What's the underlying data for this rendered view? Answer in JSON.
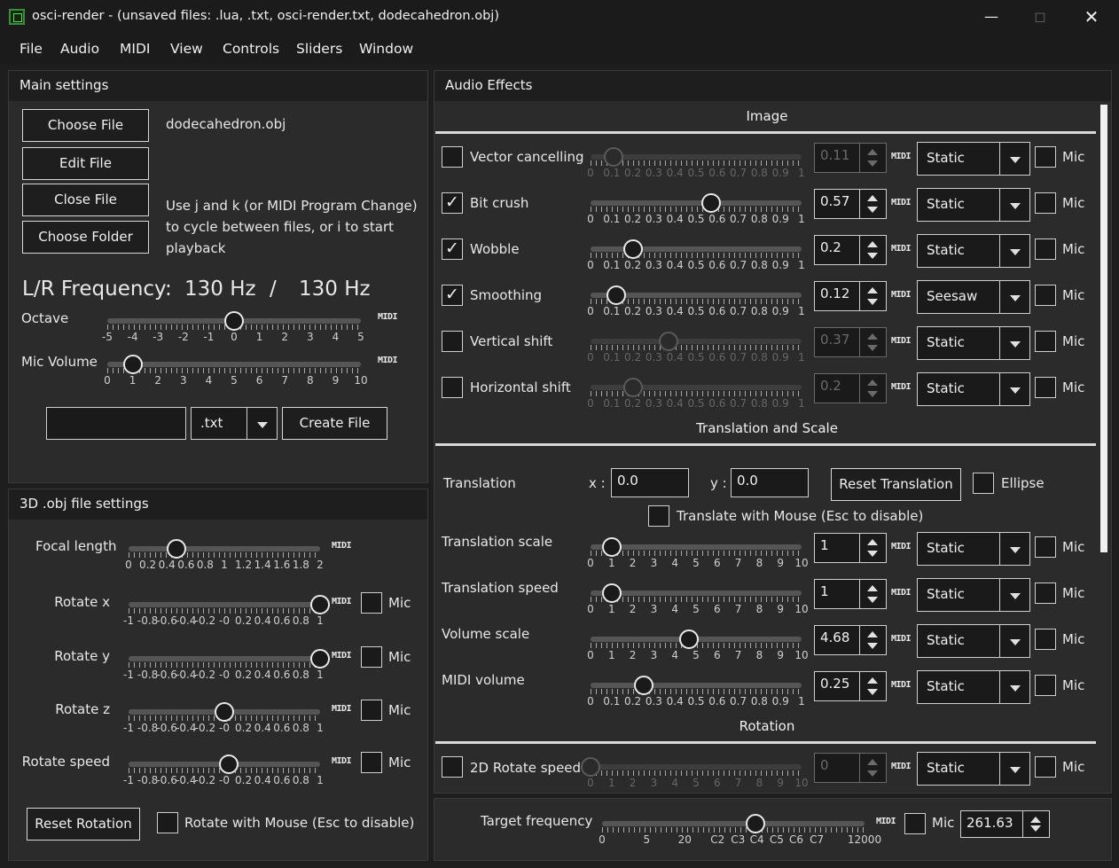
{
  "window": {
    "title": "osci-render - (unsaved files: .lua, .txt, osci-render.txt, dodecahedron.obj)",
    "controls": [
      "minimize",
      "maximize",
      "close"
    ]
  },
  "menu": [
    "File",
    "Audio",
    "MIDI",
    "View",
    "Controls",
    "Sliders",
    "Window"
  ],
  "main_settings": {
    "header": "Main settings",
    "buttons": [
      "Choose File",
      "Edit File",
      "Close File",
      "Choose Folder"
    ],
    "current_file": "dodecahedron.obj",
    "hint": [
      "Use j and k (or MIDI Program Change)",
      "to cycle between files, or i to start",
      "playback"
    ],
    "frequency_label": "L/R Frequency:",
    "frequency_left": "130 Hz",
    "frequency_sep": "/",
    "frequency_right": "130 Hz",
    "octave": {
      "label": "Octave",
      "ticks": [
        "-5",
        "-4",
        "-3",
        "-2",
        "-1",
        "0",
        "1",
        "2",
        "3",
        "4",
        "5"
      ],
      "value": 0,
      "min": -5,
      "max": 5
    },
    "mic_volume": {
      "label": "Mic Volume",
      "ticks": [
        "0",
        "1",
        "2",
        "3",
        "4",
        "5",
        "6",
        "7",
        "8",
        "9",
        "10"
      ],
      "value": 1,
      "min": 0,
      "max": 10
    },
    "new_file_name": "",
    "extension": ".txt",
    "create_label": "Create File"
  },
  "obj_settings": {
    "header": "3D .obj file settings",
    "focal": {
      "label": "Focal length",
      "ticks": [
        "0",
        "0.2",
        "0.4",
        "0.6",
        "0.8",
        "1",
        "1.2",
        "1.4",
        "1.6",
        "1.8",
        "2"
      ],
      "value": 0.5,
      "min": 0,
      "max": 2
    },
    "rows": [
      {
        "label": "Rotate x",
        "value": 1,
        "mic": false
      },
      {
        "label": "Rotate y",
        "value": 1,
        "mic": false
      },
      {
        "label": "Rotate z",
        "value": 0,
        "mic": false
      },
      {
        "label": "Rotate speed",
        "value": 0.05,
        "mic": false
      }
    ],
    "rot_ticks": [
      "-1",
      "-0.8",
      "-0.6",
      "-0.4",
      "-0.2",
      "-0",
      "0.2",
      "0.4",
      "0.6",
      "0.8",
      "1"
    ],
    "mic_label": "Mic",
    "reset_rotation": "Reset Rotation",
    "rotate_mouse": "Rotate with Mouse (Esc to disable)"
  },
  "effects": {
    "header": "Audio Effects",
    "image_title": "Image",
    "translation_title": "Translation and Scale",
    "rotation_title": "Rotation",
    "image_rows": [
      {
        "label": "Vector cancelling",
        "checked": false,
        "value": "0.11",
        "num": 0.11,
        "mode": "Static"
      },
      {
        "label": "Bit crush",
        "checked": true,
        "value": "0.57",
        "num": 0.57,
        "mode": "Static"
      },
      {
        "label": "Wobble",
        "checked": true,
        "value": "0.2",
        "num": 0.2,
        "mode": "Static"
      },
      {
        "label": "Smoothing",
        "checked": true,
        "value": "0.12",
        "num": 0.12,
        "mode": "Seesaw"
      },
      {
        "label": "Vertical shift",
        "checked": false,
        "value": "0.37",
        "num": 0.37,
        "mode": "Static"
      },
      {
        "label": "Horizontal shift",
        "checked": false,
        "value": "0.2",
        "num": 0.2,
        "mode": "Static"
      }
    ],
    "unit_ticks": [
      "0",
      "0.1",
      "0.2",
      "0.3",
      "0.4",
      "0.5",
      "0.6",
      "0.7",
      "0.8",
      "0.9",
      "1"
    ],
    "ten_ticks": [
      "0",
      "1",
      "2",
      "3",
      "4",
      "5",
      "6",
      "7",
      "8",
      "9",
      "10"
    ],
    "translation": {
      "label": "Translation",
      "x_label": "x :",
      "x": "0.0",
      "y_label": "y :",
      "y": "0.0",
      "reset": "Reset Translation",
      "ellipse": "Ellipse",
      "mouse": "Translate with Mouse (Esc to disable)"
    },
    "ts_rows": [
      {
        "label": "Translation scale",
        "value": "1",
        "num": 1,
        "max": 10,
        "mode": "Static"
      },
      {
        "label": "Translation speed",
        "value": "1",
        "num": 1,
        "max": 10,
        "mode": "Static"
      },
      {
        "label": "Volume scale",
        "value": "4.68",
        "num": 4.68,
        "max": 10,
        "mode": "Static"
      },
      {
        "label": "MIDI volume",
        "value": "0.25",
        "num": 0.25,
        "max": 1,
        "mode": "Static"
      }
    ],
    "rotate2d": {
      "label": "2D Rotate speed",
      "value": "0",
      "num": 0,
      "mode": "Static"
    },
    "mic_label": "Mic",
    "midi_label": "MIDI"
  },
  "target": {
    "label": "Target frequency",
    "ticks": [
      "0",
      "5",
      "20",
      "C2",
      "C3",
      "C4",
      "C5",
      "C6",
      "C7",
      "12000"
    ],
    "value": "261.63",
    "mic_label": "Mic"
  }
}
